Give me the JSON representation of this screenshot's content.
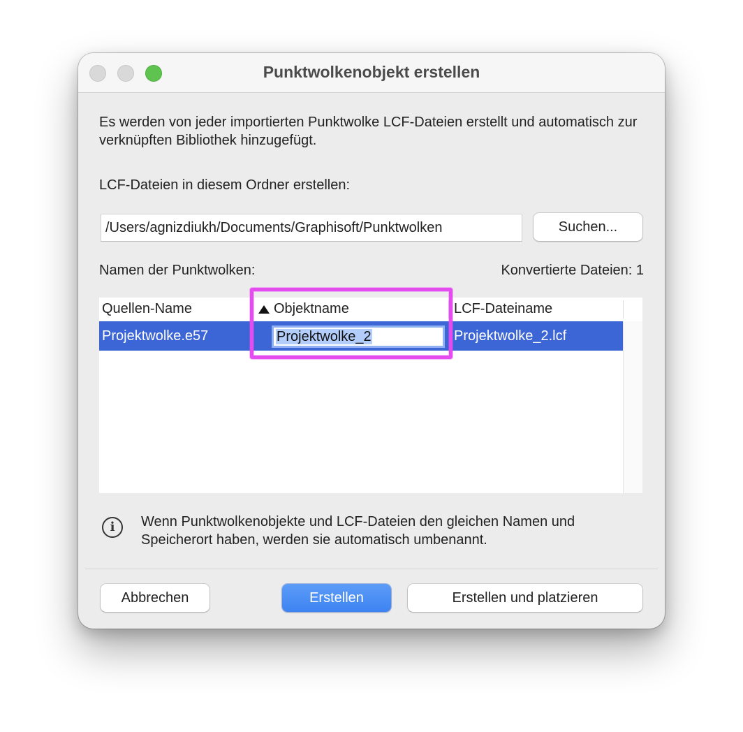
{
  "window": {
    "title": "Punktwolkenobjekt erstellen"
  },
  "description": "Es werden von jeder importierten Punktwolke LCF-Dateien erstellt und automatisch zur verknüpften Bibliothek hinzugefügt.",
  "folder": {
    "label": "LCF-Dateien in diesem Ordner erstellen:",
    "path": "/Users/agnizdiukh/Documents/Graphisoft/Punktwolken",
    "browse_label": "Suchen..."
  },
  "names_label": "Namen der Punktwolken:",
  "converted_label": "Konvertierte Dateien: 1",
  "table": {
    "columns": [
      "Quellen-Name",
      "Objektname",
      "LCF-Dateiname"
    ],
    "sort_column": "Objektname",
    "sort_direction": "ascending",
    "rows": [
      {
        "source": "Projektwolke.e57",
        "object_name": "Projektwolke_2",
        "lcf_name": "Projektwolke_2.lcf",
        "selected": true,
        "editing": "object_name"
      }
    ]
  },
  "info": {
    "icon": "info-icon",
    "text": "Wenn Punktwolkenobjekte und LCF-Dateien den gleichen Namen und Speicherort haben, werden sie automatisch umbenannt."
  },
  "buttons": {
    "cancel": "Abbrechen",
    "create": "Erstellen",
    "create_place": "Erstellen und platzieren"
  },
  "colors": {
    "selection": "#3c65d6",
    "primary_button": "#3d83f2",
    "highlight": "#e44cf0",
    "zoom_button": "#5ec44f"
  }
}
